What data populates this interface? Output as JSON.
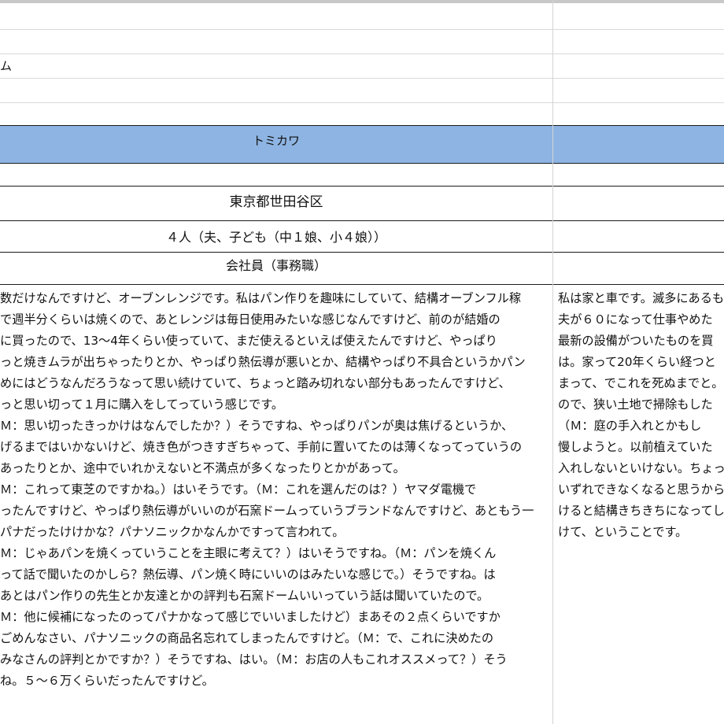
{
  "cells": {
    "row3_label": "ム",
    "header_name": "トミカワ",
    "address": "東京都世田谷区",
    "family": "４人（夫、子ども（中１娘、小４娘））",
    "occupation": "会社員（事務職）"
  },
  "interview_b": [
    "数だけなんですけど、オーブンレンジです。私はパン作りを趣味にしていて、結構オーブンフル稼",
    "で週半分くらいは焼くので、あとレンジは毎日使用みたいな感じなんですけど、前のが結婚の",
    "に買ったので、13～4年くらい使っていて、まだ使えるといえば使えたんですけど、やっぱり",
    "っと焼きムラが出ちゃったりとか、やっぱり熱伝導が悪いとか、結構やっぱり不具合というかパン",
    "めにはどうなんだろうなって思い続けていて、ちょっと踏み切れない部分もあったんですけど、",
    "っと思い切って１月に購入をしてっていう感じです。",
    "Ｍ：思い切ったきっかけはなんでしたか？）そうですね、やっぱりパンが奥は焦げるというか、",
    "げるまではいかないけど、焼き色がつきすぎちゃって、手前に置いてたのは薄くなってっていうの",
    "あったりとか、途中でいれかえないと不満点が多くなったりとかがあって。",
    "Ｍ：これって東芝のですかね。）はいそうです。（Ｍ：これを選んだのは？）ヤマダ電機で",
    "ったんですけど、やっぱり熱伝導がいいのが石窯ドームっていうブランドなんですけど、あともう一",
    "パナだったけけかな？パナソニックかなんかですって言われて。",
    "Ｍ：じゃあパンを焼くっていうことを主眼に考えて？）はいそうですね。（Ｍ：パンを焼くん",
    "って話で聞いたのかしら？熱伝導、パン焼く時にいいのはみたいな感じで。）そうですね。は",
    "あとはパン作りの先生とか友達とかの評判も石窯ドームいいっていう話は聞いていたので。",
    "Ｍ：他に候補になったのってパナかなって感じでいいましたけど）まあその２点くらいですか",
    "ごめんなさい、パナソニックの商品名忘れてしまったんですけど。（Ｍ：で、これに決めたの",
    "みなさんの評判とかですか？）そうですね、はい。（Ｍ：お店の人もこれオススメって？）そう",
    "ね。５～６万くらいだったんですけど。"
  ],
  "interview_c": [
    "私は家と車です。滅多にあるも",
    "夫が６０になって仕事やめた",
    "最新の設備がついたものを買",
    "は。家って20年くらい経つと",
    "まって、でこれを死ぬまでと。",
    "ので、狭い土地で掃除もした",
    "（Ｍ：庭の手入れとかもし",
    "慢しようと。以前植えていた",
    "入れしないといけない。ちょっ",
    "いずれできなくなると思うから",
    "けると結構きちきちになってし",
    "けて、ということです。"
  ]
}
